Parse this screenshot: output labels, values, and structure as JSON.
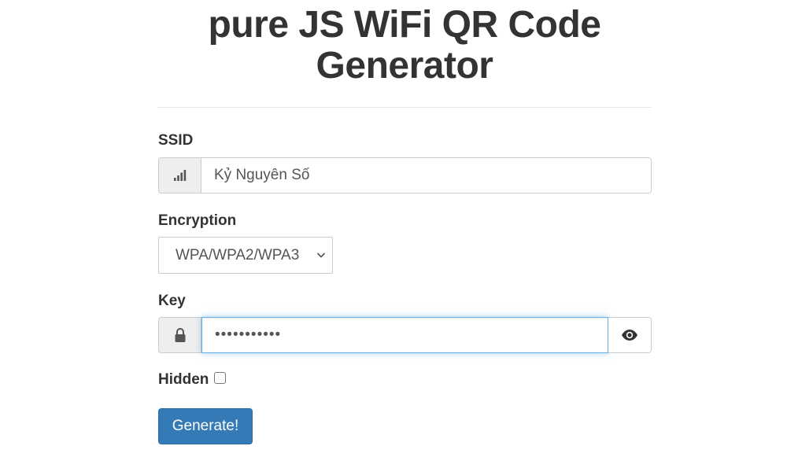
{
  "header": {
    "title": "pure JS WiFi QR Code Generator"
  },
  "form": {
    "ssid": {
      "label": "SSID",
      "value": "Kỷ Nguyên Số",
      "icon": "signal-icon"
    },
    "encryption": {
      "label": "Encryption",
      "selected": "WPA/WPA2/WPA3"
    },
    "key": {
      "label": "Key",
      "value": "•••••••••••",
      "icon": "lock-icon",
      "toggle_icon": "eye-icon"
    },
    "hidden": {
      "label": "Hidden",
      "checked": false
    },
    "generate_label": "Generate!"
  },
  "colors": {
    "primary": "#337ab7",
    "focus": "#66afe9",
    "text": "#333333",
    "addon_bg": "#eeeeee"
  }
}
